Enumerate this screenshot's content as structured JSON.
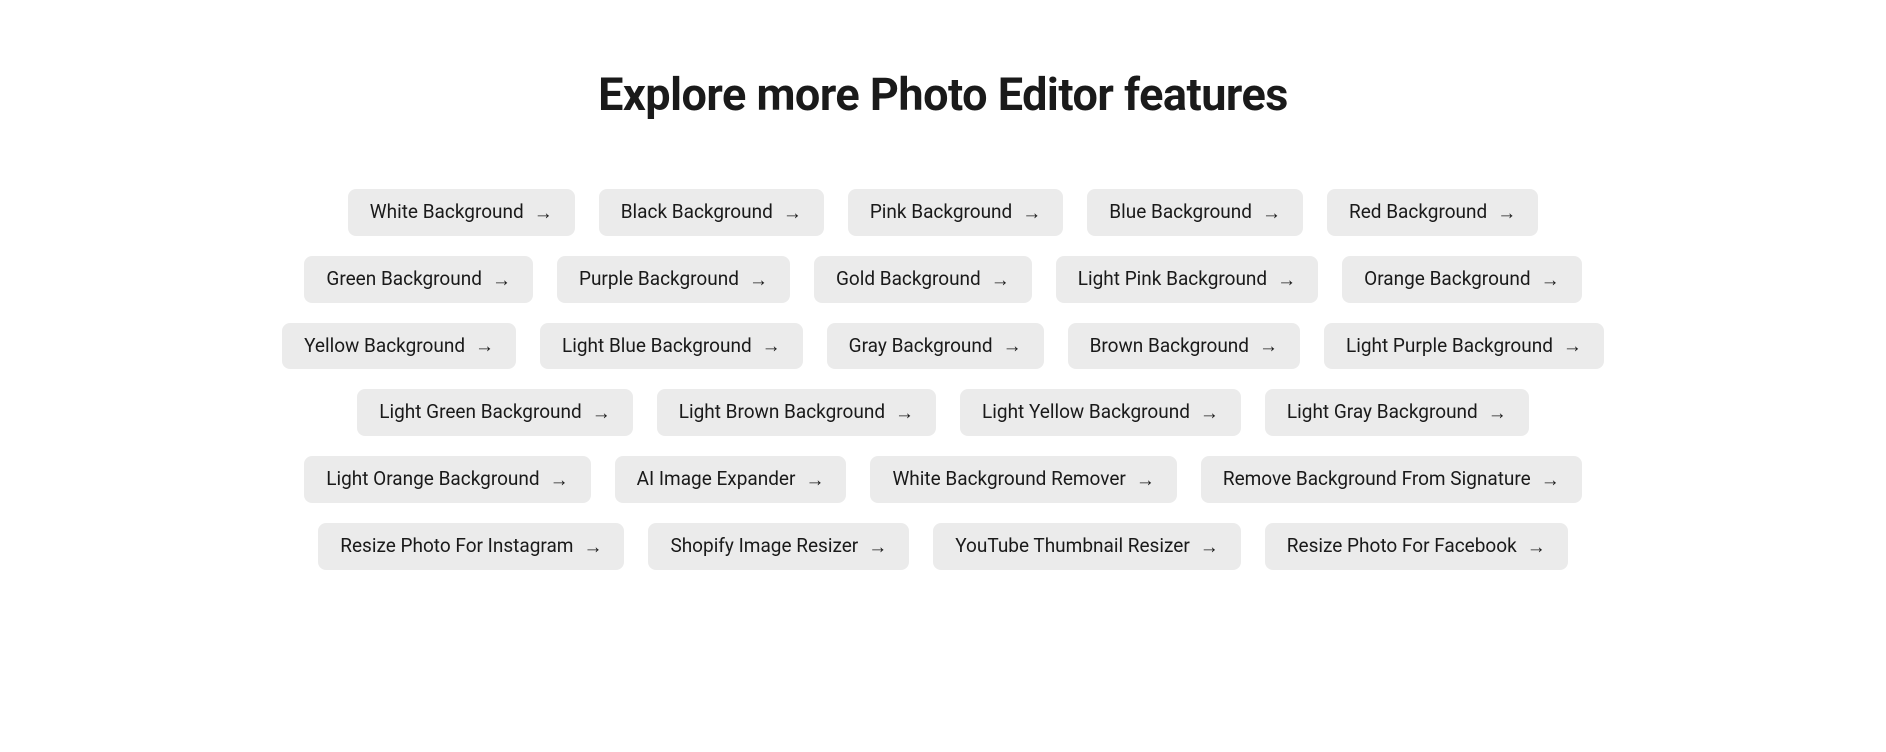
{
  "heading": "Explore more Photo Editor features",
  "chips": [
    {
      "label": "White Background"
    },
    {
      "label": "Black Background"
    },
    {
      "label": "Pink Background"
    },
    {
      "label": "Blue Background"
    },
    {
      "label": "Red Background"
    },
    {
      "label": "Green Background"
    },
    {
      "label": "Purple Background"
    },
    {
      "label": "Gold Background"
    },
    {
      "label": "Light Pink Background"
    },
    {
      "label": "Orange Background"
    },
    {
      "label": "Yellow Background"
    },
    {
      "label": "Light Blue Background"
    },
    {
      "label": "Gray Background"
    },
    {
      "label": "Brown Background"
    },
    {
      "label": "Light Purple Background"
    },
    {
      "label": "Light Green Background"
    },
    {
      "label": "Light Brown Background"
    },
    {
      "label": "Light Yellow Background"
    },
    {
      "label": "Light Gray Background"
    },
    {
      "label": "Light Orange Background"
    },
    {
      "label": "AI Image Expander"
    },
    {
      "label": "White Background Remover"
    },
    {
      "label": "Remove Background From Signature"
    },
    {
      "label": "Resize Photo For Instagram"
    },
    {
      "label": "Shopify Image Resizer"
    },
    {
      "label": "YouTube Thumbnail Resizer"
    },
    {
      "label": "Resize Photo For Facebook"
    }
  ]
}
